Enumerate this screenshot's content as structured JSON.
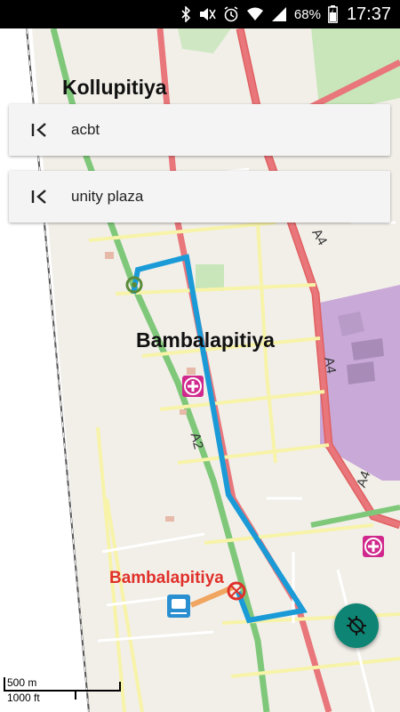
{
  "status_bar": {
    "icons": [
      "bluetooth-icon",
      "mute-icon",
      "alarm-icon",
      "wifi-icon",
      "signal-icon",
      "battery-icon"
    ],
    "battery": "68%",
    "time": "17:37"
  },
  "search": {
    "from": "acbt",
    "to": "unity plaza"
  },
  "map": {
    "labels": {
      "kollupitiya": "Kollupitiya",
      "bambalapitiya_area": "Bambalapitiya",
      "bambalapitiya_station": "Bambalapitiya"
    },
    "roads": {
      "a4_top": "A4",
      "a4_mid": "A4",
      "a4_low": "A4",
      "a2": "A2"
    },
    "colors": {
      "route": "#1a9bd7",
      "fab": "#0e8574",
      "station_label": "#e0302a",
      "hospital": "#d0288c"
    }
  },
  "scale": {
    "metric": "500 m",
    "imperial": "1000 ft"
  }
}
